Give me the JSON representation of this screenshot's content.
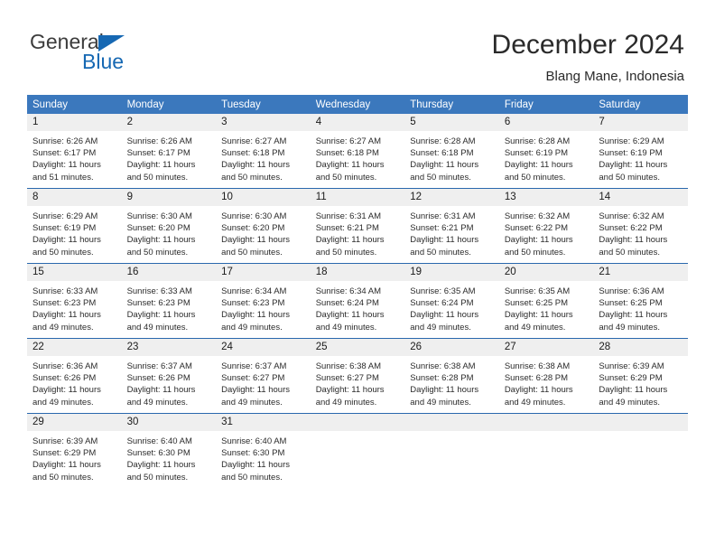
{
  "brand": {
    "name_top": "General",
    "name_bottom": "Blue",
    "accent_color": "#1668b3"
  },
  "header": {
    "title": "December 2024",
    "subtitle": "Blang Mane, Indonesia",
    "header_bg_color": "#3b78bd",
    "daynum_bg_color": "#efefef"
  },
  "weekdays": [
    "Sunday",
    "Monday",
    "Tuesday",
    "Wednesday",
    "Thursday",
    "Friday",
    "Saturday"
  ],
  "weeks": [
    [
      {
        "day": "1",
        "sunrise": "Sunrise: 6:26 AM",
        "sunset": "Sunset: 6:17 PM",
        "daylight1": "Daylight: 11 hours",
        "daylight2": "and 51 minutes."
      },
      {
        "day": "2",
        "sunrise": "Sunrise: 6:26 AM",
        "sunset": "Sunset: 6:17 PM",
        "daylight1": "Daylight: 11 hours",
        "daylight2": "and 50 minutes."
      },
      {
        "day": "3",
        "sunrise": "Sunrise: 6:27 AM",
        "sunset": "Sunset: 6:18 PM",
        "daylight1": "Daylight: 11 hours",
        "daylight2": "and 50 minutes."
      },
      {
        "day": "4",
        "sunrise": "Sunrise: 6:27 AM",
        "sunset": "Sunset: 6:18 PM",
        "daylight1": "Daylight: 11 hours",
        "daylight2": "and 50 minutes."
      },
      {
        "day": "5",
        "sunrise": "Sunrise: 6:28 AM",
        "sunset": "Sunset: 6:18 PM",
        "daylight1": "Daylight: 11 hours",
        "daylight2": "and 50 minutes."
      },
      {
        "day": "6",
        "sunrise": "Sunrise: 6:28 AM",
        "sunset": "Sunset: 6:19 PM",
        "daylight1": "Daylight: 11 hours",
        "daylight2": "and 50 minutes."
      },
      {
        "day": "7",
        "sunrise": "Sunrise: 6:29 AM",
        "sunset": "Sunset: 6:19 PM",
        "daylight1": "Daylight: 11 hours",
        "daylight2": "and 50 minutes."
      }
    ],
    [
      {
        "day": "8",
        "sunrise": "Sunrise: 6:29 AM",
        "sunset": "Sunset: 6:19 PM",
        "daylight1": "Daylight: 11 hours",
        "daylight2": "and 50 minutes."
      },
      {
        "day": "9",
        "sunrise": "Sunrise: 6:30 AM",
        "sunset": "Sunset: 6:20 PM",
        "daylight1": "Daylight: 11 hours",
        "daylight2": "and 50 minutes."
      },
      {
        "day": "10",
        "sunrise": "Sunrise: 6:30 AM",
        "sunset": "Sunset: 6:20 PM",
        "daylight1": "Daylight: 11 hours",
        "daylight2": "and 50 minutes."
      },
      {
        "day": "11",
        "sunrise": "Sunrise: 6:31 AM",
        "sunset": "Sunset: 6:21 PM",
        "daylight1": "Daylight: 11 hours",
        "daylight2": "and 50 minutes."
      },
      {
        "day": "12",
        "sunrise": "Sunrise: 6:31 AM",
        "sunset": "Sunset: 6:21 PM",
        "daylight1": "Daylight: 11 hours",
        "daylight2": "and 50 minutes."
      },
      {
        "day": "13",
        "sunrise": "Sunrise: 6:32 AM",
        "sunset": "Sunset: 6:22 PM",
        "daylight1": "Daylight: 11 hours",
        "daylight2": "and 50 minutes."
      },
      {
        "day": "14",
        "sunrise": "Sunrise: 6:32 AM",
        "sunset": "Sunset: 6:22 PM",
        "daylight1": "Daylight: 11 hours",
        "daylight2": "and 50 minutes."
      }
    ],
    [
      {
        "day": "15",
        "sunrise": "Sunrise: 6:33 AM",
        "sunset": "Sunset: 6:23 PM",
        "daylight1": "Daylight: 11 hours",
        "daylight2": "and 49 minutes."
      },
      {
        "day": "16",
        "sunrise": "Sunrise: 6:33 AM",
        "sunset": "Sunset: 6:23 PM",
        "daylight1": "Daylight: 11 hours",
        "daylight2": "and 49 minutes."
      },
      {
        "day": "17",
        "sunrise": "Sunrise: 6:34 AM",
        "sunset": "Sunset: 6:23 PM",
        "daylight1": "Daylight: 11 hours",
        "daylight2": "and 49 minutes."
      },
      {
        "day": "18",
        "sunrise": "Sunrise: 6:34 AM",
        "sunset": "Sunset: 6:24 PM",
        "daylight1": "Daylight: 11 hours",
        "daylight2": "and 49 minutes."
      },
      {
        "day": "19",
        "sunrise": "Sunrise: 6:35 AM",
        "sunset": "Sunset: 6:24 PM",
        "daylight1": "Daylight: 11 hours",
        "daylight2": "and 49 minutes."
      },
      {
        "day": "20",
        "sunrise": "Sunrise: 6:35 AM",
        "sunset": "Sunset: 6:25 PM",
        "daylight1": "Daylight: 11 hours",
        "daylight2": "and 49 minutes."
      },
      {
        "day": "21",
        "sunrise": "Sunrise: 6:36 AM",
        "sunset": "Sunset: 6:25 PM",
        "daylight1": "Daylight: 11 hours",
        "daylight2": "and 49 minutes."
      }
    ],
    [
      {
        "day": "22",
        "sunrise": "Sunrise: 6:36 AM",
        "sunset": "Sunset: 6:26 PM",
        "daylight1": "Daylight: 11 hours",
        "daylight2": "and 49 minutes."
      },
      {
        "day": "23",
        "sunrise": "Sunrise: 6:37 AM",
        "sunset": "Sunset: 6:26 PM",
        "daylight1": "Daylight: 11 hours",
        "daylight2": "and 49 minutes."
      },
      {
        "day": "24",
        "sunrise": "Sunrise: 6:37 AM",
        "sunset": "Sunset: 6:27 PM",
        "daylight1": "Daylight: 11 hours",
        "daylight2": "and 49 minutes."
      },
      {
        "day": "25",
        "sunrise": "Sunrise: 6:38 AM",
        "sunset": "Sunset: 6:27 PM",
        "daylight1": "Daylight: 11 hours",
        "daylight2": "and 49 minutes."
      },
      {
        "day": "26",
        "sunrise": "Sunrise: 6:38 AM",
        "sunset": "Sunset: 6:28 PM",
        "daylight1": "Daylight: 11 hours",
        "daylight2": "and 49 minutes."
      },
      {
        "day": "27",
        "sunrise": "Sunrise: 6:38 AM",
        "sunset": "Sunset: 6:28 PM",
        "daylight1": "Daylight: 11 hours",
        "daylight2": "and 49 minutes."
      },
      {
        "day": "28",
        "sunrise": "Sunrise: 6:39 AM",
        "sunset": "Sunset: 6:29 PM",
        "daylight1": "Daylight: 11 hours",
        "daylight2": "and 49 minutes."
      }
    ],
    [
      {
        "day": "29",
        "sunrise": "Sunrise: 6:39 AM",
        "sunset": "Sunset: 6:29 PM",
        "daylight1": "Daylight: 11 hours",
        "daylight2": "and 50 minutes."
      },
      {
        "day": "30",
        "sunrise": "Sunrise: 6:40 AM",
        "sunset": "Sunset: 6:30 PM",
        "daylight1": "Daylight: 11 hours",
        "daylight2": "and 50 minutes."
      },
      {
        "day": "31",
        "sunrise": "Sunrise: 6:40 AM",
        "sunset": "Sunset: 6:30 PM",
        "daylight1": "Daylight: 11 hours",
        "daylight2": "and 50 minutes."
      },
      {
        "day": "",
        "sunrise": "",
        "sunset": "",
        "daylight1": "",
        "daylight2": ""
      },
      {
        "day": "",
        "sunrise": "",
        "sunset": "",
        "daylight1": "",
        "daylight2": ""
      },
      {
        "day": "",
        "sunrise": "",
        "sunset": "",
        "daylight1": "",
        "daylight2": ""
      },
      {
        "day": "",
        "sunrise": "",
        "sunset": "",
        "daylight1": "",
        "daylight2": ""
      }
    ]
  ]
}
